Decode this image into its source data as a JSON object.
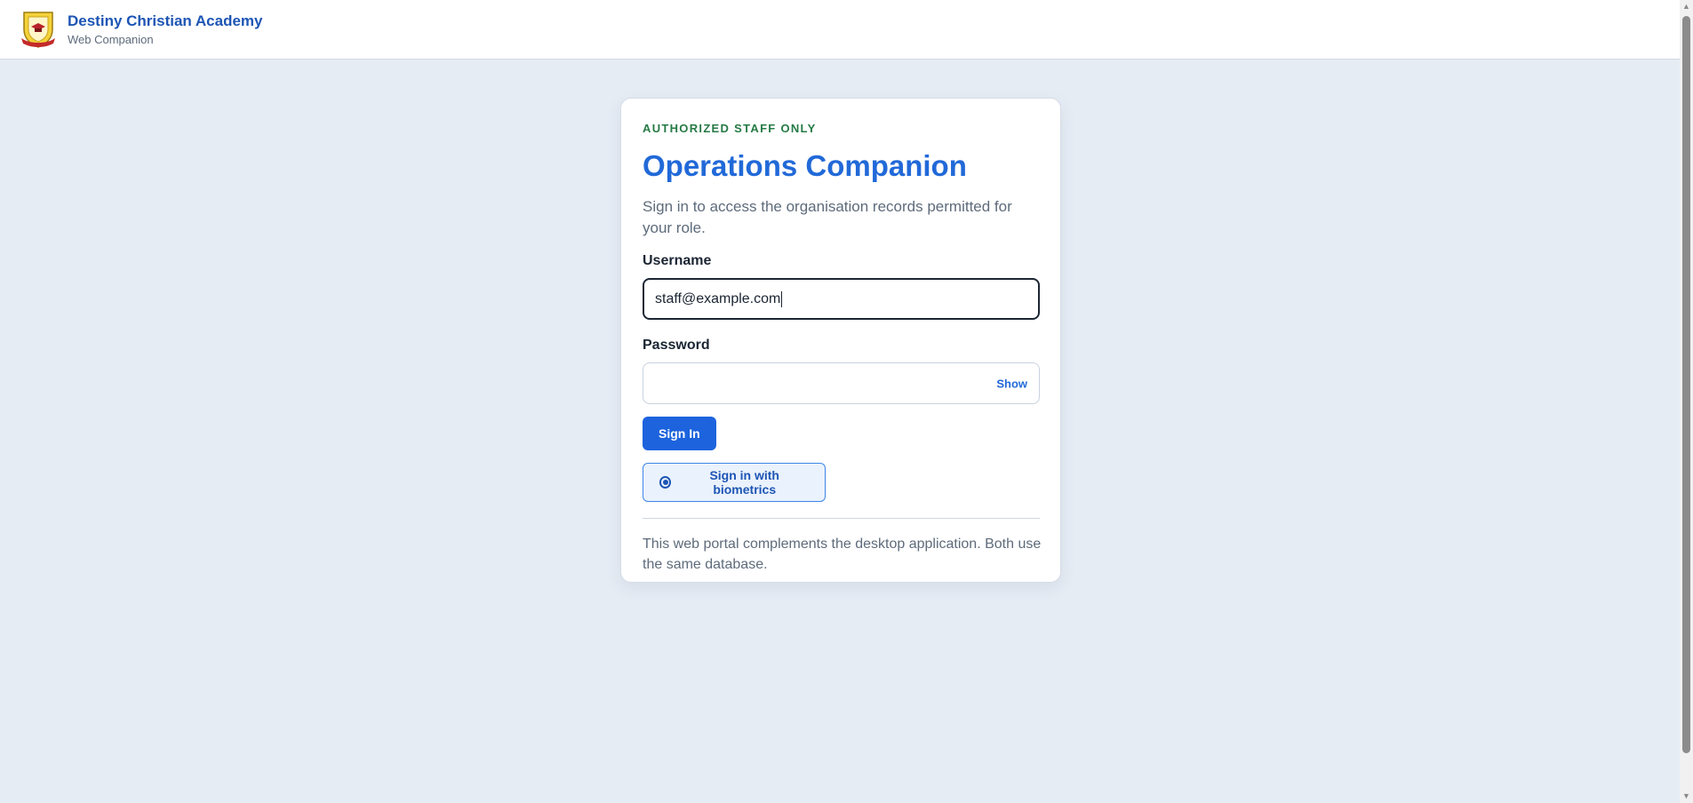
{
  "header": {
    "brand_title": "Destiny Christian Academy",
    "brand_subtitle": "Web Companion",
    "logo_icon": "school-crest-icon"
  },
  "login": {
    "eyebrow": "AUTHORIZED STAFF ONLY",
    "title": "Operations Companion",
    "description": "Sign in to access the organisation records permitted for your role.",
    "username_label": "Username",
    "username_value": "staff@example.com",
    "password_label": "Password",
    "password_value": "",
    "show_label": "Show",
    "signin_label": "Sign In",
    "biometric_label": "Sign in with biometrics",
    "biometric_icon": "fingerprint-icon",
    "footnote": "This web portal complements the desktop application. Both use the same database."
  },
  "colors": {
    "brand_blue": "#1d55b4",
    "accent_blue": "#2169d8",
    "primary_button": "#1c63dd",
    "eyebrow_green": "#257a45",
    "page_background": "#e6ecf4"
  }
}
